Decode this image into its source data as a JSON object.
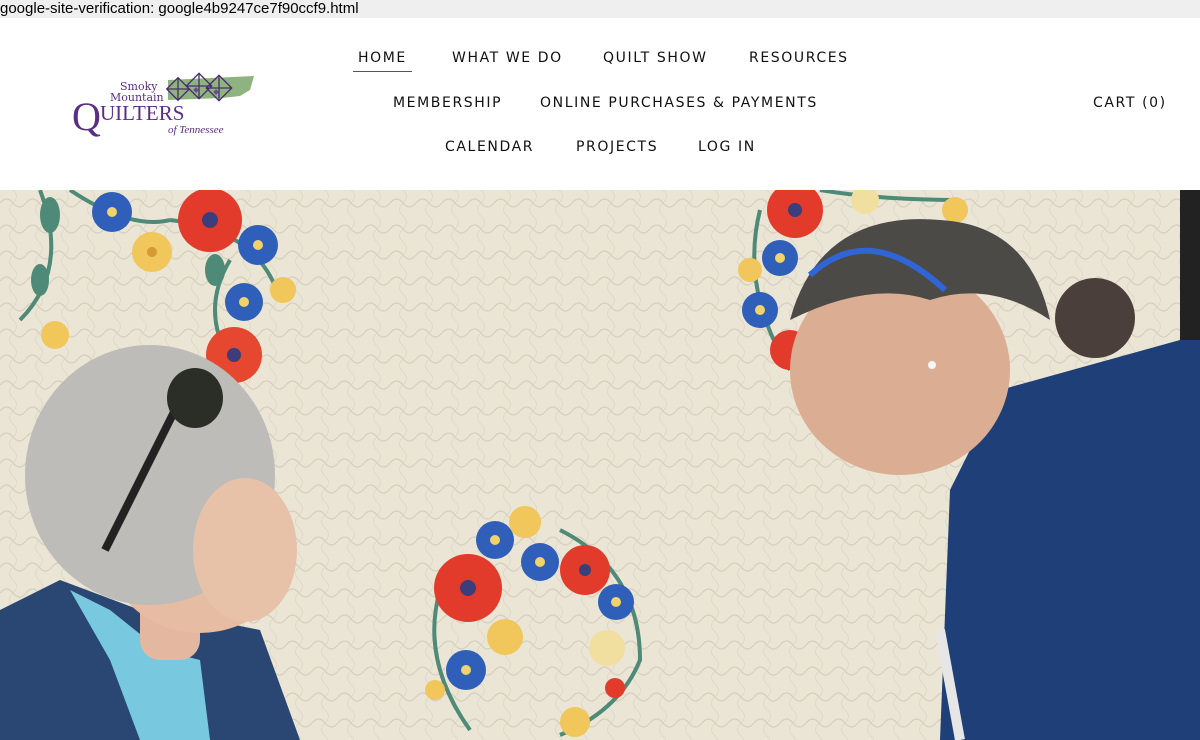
{
  "verification_text": "google-site-verification: google4b9247ce7f90ccf9.html",
  "logo": {
    "line1": "Smoky",
    "line2": "Mountain",
    "big_q": "Q",
    "rest": "UILTERS",
    "sub": "of Tennessee"
  },
  "nav": {
    "home": "HOME",
    "what_we_do": "WHAT WE DO",
    "quilt_show": "QUILT SHOW",
    "resources": "RESOURCES",
    "membership": "MEMBERSHIP",
    "online": "ONLINE PURCHASES & PAYMENTS",
    "calendar": "CALENDAR",
    "projects": "PROJECTS",
    "login": "LOG IN"
  },
  "cart_label": "CART (0)",
  "colors": {
    "brand_purple": "#5a2d86",
    "quilt_cream": "#ece6d6",
    "jacket_navy": "#1f3f78"
  }
}
